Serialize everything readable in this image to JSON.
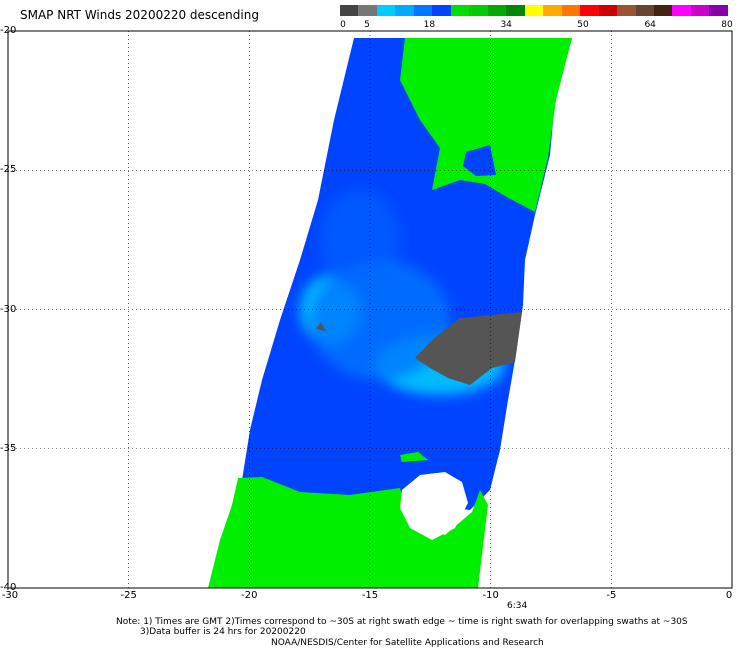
{
  "title": "SMAP NRT Winds  20200220 descending",
  "colorbar": {
    "labels": [
      {
        "text": "0",
        "value": 0
      },
      {
        "text": "5",
        "value": 5
      },
      {
        "text": "18",
        "value": 18
      },
      {
        "text": "34",
        "value": 34
      },
      {
        "text": "50",
        "value": 50
      },
      {
        "text": "64",
        "value": 64
      },
      {
        "text": "80",
        "value": 80
      }
    ],
    "segments": [
      "#444444",
      "#777777",
      "#00ccff",
      "#00aaff",
      "#0077ff",
      "#0044ff",
      "#00dd00",
      "#00cc00",
      "#00aa00",
      "#008800",
      "#ffff00",
      "#ffaa00",
      "#ff7700",
      "#ff0000",
      "#cc0000",
      "#995533",
      "#664433",
      "#442211",
      "#ff00ff",
      "#cc00cc",
      "#8800aa"
    ]
  },
  "map": {
    "lat_range": [
      -40,
      -20
    ],
    "lon_range": [
      -30,
      0
    ],
    "y_ticks": [
      "-20",
      "-25",
      "-30",
      "-35",
      "-40"
    ],
    "x_ticks": [
      "-30",
      "-25",
      "-20",
      "-15",
      "-10",
      "-5",
      "0"
    ],
    "colors": {
      "swath_blue": "#0044ff",
      "light_blue": "#00ccff",
      "green": "#00ee00",
      "no_data_gray": "#555555"
    }
  },
  "time_label": "6:34",
  "notes": {
    "line1": "Note: 1) Times are GMT 2)Times correspond to ~30S at right swath edge ~ time is right swath for overlapping swaths at ~30S",
    "line2": "3)Data buffer is 24 hrs for 20200220",
    "line3": "NOAA/NESDIS/Center for Satellite Applications and Research"
  }
}
